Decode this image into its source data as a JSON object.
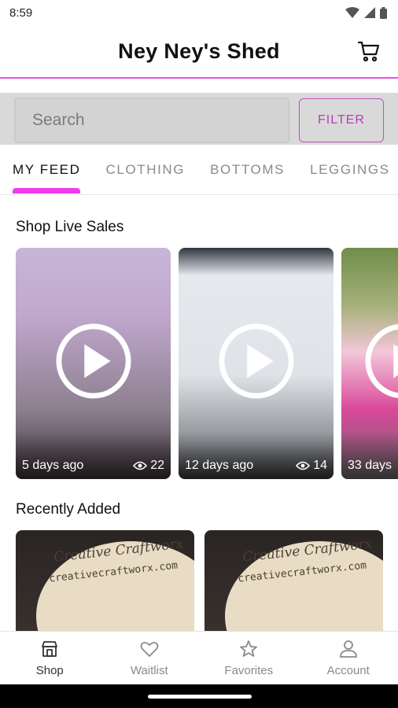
{
  "status_bar": {
    "time": "8:59",
    "icons": [
      "wifi-icon",
      "signal-icon",
      "battery-icon"
    ]
  },
  "header": {
    "title": "Ney Ney's Shed",
    "cart_icon": "cart-icon"
  },
  "search": {
    "placeholder": "Search",
    "filter_label": "FILTER"
  },
  "tabs": [
    {
      "label": "MY FEED",
      "active": true
    },
    {
      "label": "CLOTHING",
      "active": false
    },
    {
      "label": "BOTTOMS",
      "active": false
    },
    {
      "label": "LEGGINGS",
      "active": false
    }
  ],
  "live_sales": {
    "title": "Shop Live Sales",
    "cards": [
      {
        "age": "5 days ago",
        "views": "22"
      },
      {
        "age": "12 days ago",
        "views": "14"
      },
      {
        "age": "33 days",
        "views": ""
      }
    ]
  },
  "recently_added": {
    "title": "Recently Added",
    "items": [
      {
        "brand": "Creative Craftworx",
        "url": "creativecraftworx.com"
      },
      {
        "brand": "Creative Craftworx",
        "url": "creativecraftworx.com"
      }
    ]
  },
  "bottom_nav": [
    {
      "label": "Shop",
      "icon": "store-icon",
      "active": true
    },
    {
      "label": "Waitlist",
      "icon": "heart-icon",
      "active": false
    },
    {
      "label": "Favorites",
      "icon": "star-icon",
      "active": false
    },
    {
      "label": "Account",
      "icon": "person-icon",
      "active": false
    }
  ],
  "colors": {
    "accent": "#f03cf0",
    "filter": "#b53fb5"
  }
}
